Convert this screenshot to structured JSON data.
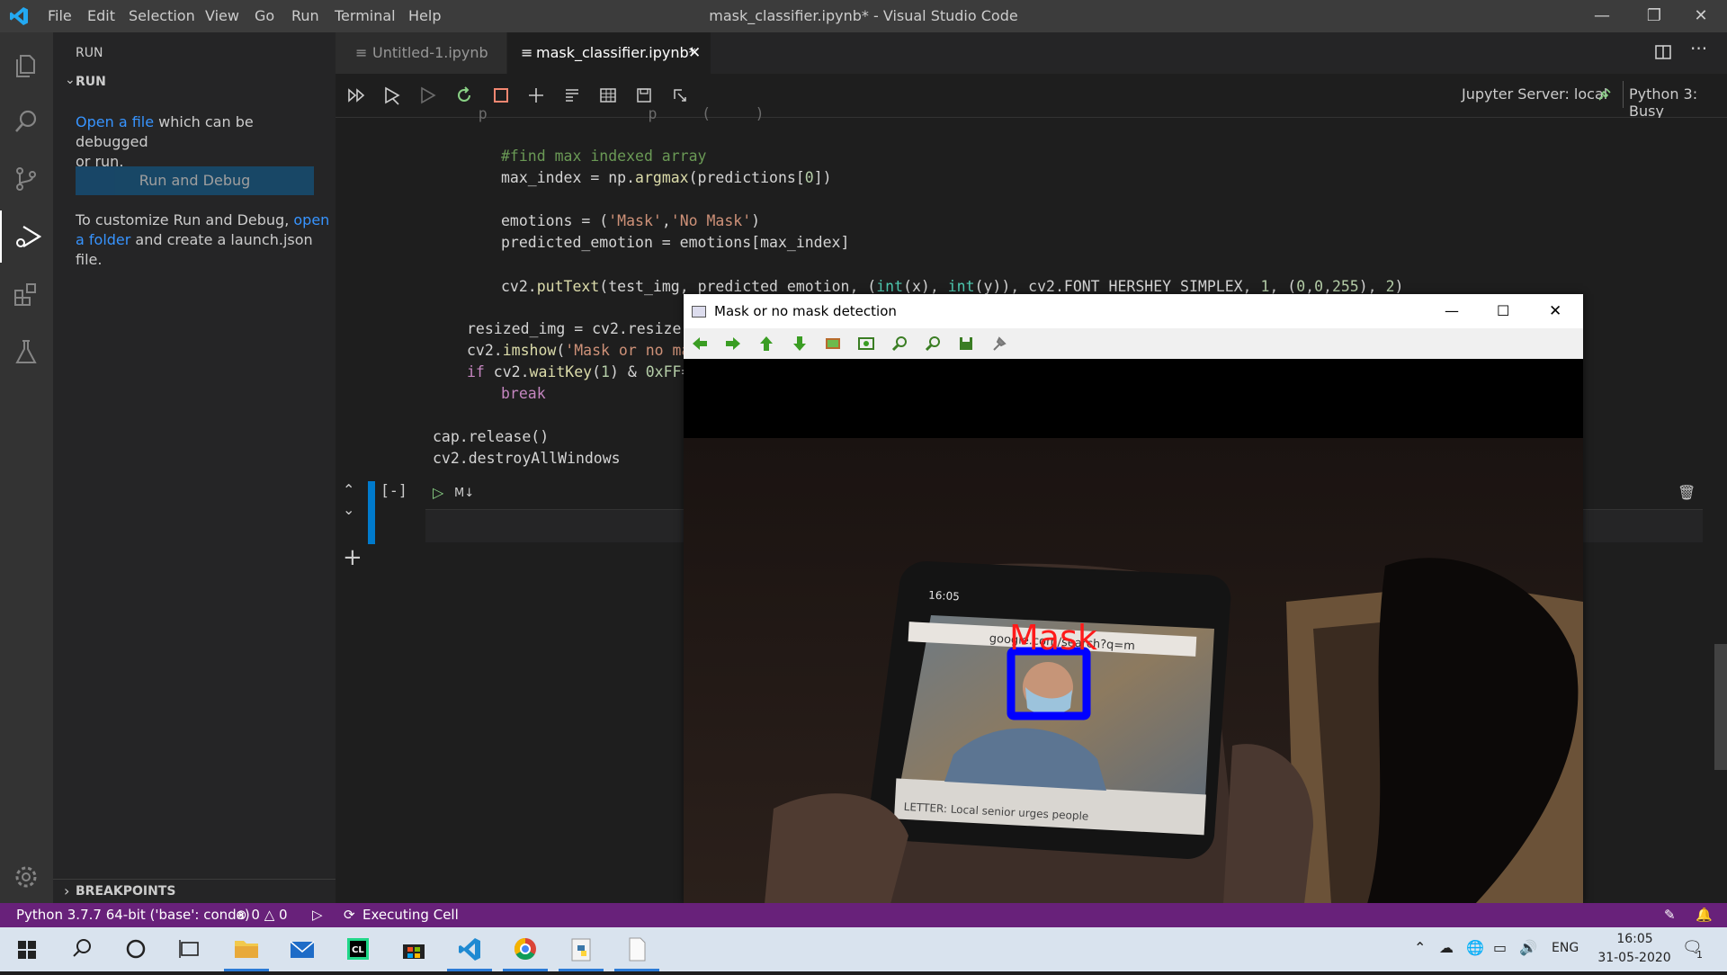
{
  "titlebar": {
    "menu": [
      "File",
      "Edit",
      "Selection",
      "View",
      "Go",
      "Run",
      "Terminal",
      "Help"
    ],
    "title": "mask_classifier.ipynb* - Visual Studio Code"
  },
  "sidebar": {
    "header": "RUN",
    "section": "RUN",
    "open_link": "Open a file",
    "open_rest1": " which can be debugged",
    "open_rest2": "or run.",
    "run_debug_button": "Run and Debug",
    "custom1": "To customize Run and Debug, ",
    "custom_link1": "open",
    "custom_link2": "a folder",
    "custom2": " and create a launch.json file.",
    "breakpoints": "BREAKPOINTS"
  },
  "tabs": [
    {
      "label": "Untitled-1.ipynb",
      "active": false
    },
    {
      "label": "mask_classifier.ipynb*",
      "active": true
    }
  ],
  "notebook": {
    "server": "Jupyter Server: local",
    "kernel": "Python 3: Busy",
    "cell_prompt": "[-]",
    "md_label": "M↓"
  },
  "code": {
    "l1_cm": "#find max indexed array",
    "l2_a": "max_index = np.",
    "l2_fn": "argmax",
    "l2_b": "(predictions[",
    "l2_n": "0",
    "l2_c": "])",
    "l3_a": "emotions = (",
    "l3_s1": "'Mask'",
    "l3_b": ",",
    "l3_s2": "'No Mask'",
    "l3_c": ")",
    "l4": "predicted_emotion = emotions[max_index]",
    "l5_a": "cv2.",
    "l5_fn": "putText",
    "l5_b": "(test_img, predicted_emotion, (",
    "l5_i1": "int",
    "l5_c": "(x), ",
    "l5_i2": "int",
    "l5_d": "(y)), cv2.FONT_HERSHEY_SIMPLEX, ",
    "l5_n1": "1",
    "l5_e": ", (",
    "l5_n2": "0",
    "l5_f": ",",
    "l5_n3": "0",
    "l5_g": ",",
    "l5_n4": "255",
    "l5_h": "), ",
    "l5_n5": "2",
    "l5_i": ")",
    "l6": "resized_img = cv2.resize(",
    "l7_a": "cv2.",
    "l7_fn": "imshow",
    "l7_b": "(",
    "l7_s": "'Mask or no ma",
    "l8_kw": "if",
    "l8_a": " cv2.",
    "l8_fn": "waitKey",
    "l8_b": "(",
    "l8_n": "1",
    "l8_c": ") & ",
    "l8_n2": "0xFF",
    "l8_d": "=",
    "l9_kw": "break",
    "l10": "cap.release()",
    "l11": "cv2.destroyAllWindows"
  },
  "cv_window": {
    "title": "Mask or no mask detection",
    "label": "Mask",
    "phone_time": "16:05",
    "phone_url": "google.com/search?q=m",
    "phone_caption": "LETTER: Local senior urges people"
  },
  "statusbar": {
    "python": "Python 3.7.7 64-bit ('base': conda)",
    "errors": "0",
    "warnings": "0",
    "executing": "Executing Cell"
  },
  "taskbar": {
    "lang": "ENG",
    "time": "16:05",
    "date": "31-05-2020",
    "notif_count": "1"
  },
  "colors": {
    "status": "#68217a",
    "accent": "#007acc"
  }
}
